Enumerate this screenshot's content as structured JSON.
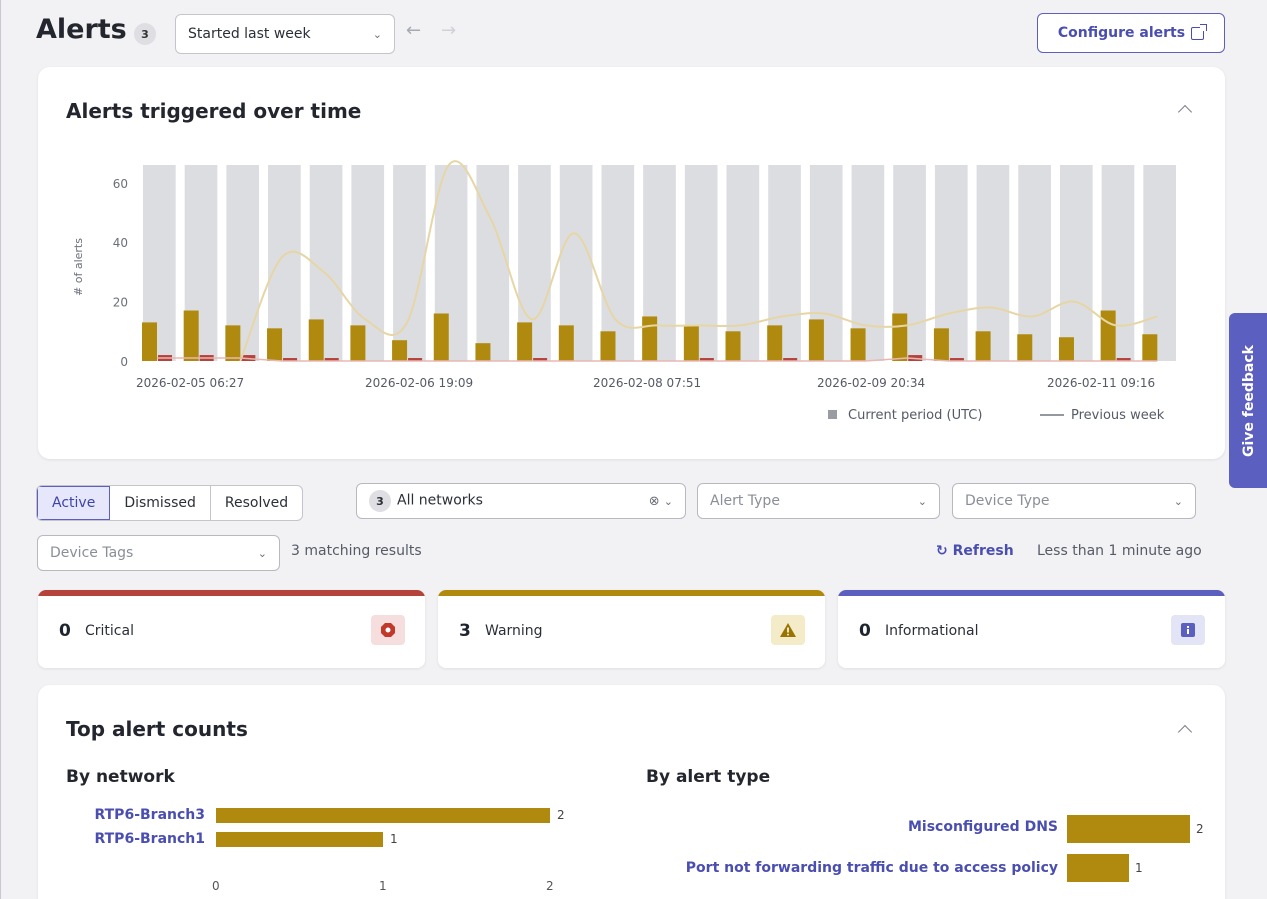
{
  "header": {
    "title": "Alerts",
    "count": "3",
    "period": "Started last week",
    "configure_label": "Configure alerts"
  },
  "chart_card": {
    "title": "Alerts triggered over time"
  },
  "chart_data": {
    "type": "bar",
    "ylabel": "# of alerts",
    "ylim": [
      0,
      66
    ],
    "yticks": [
      "0",
      "20",
      "40",
      "60"
    ],
    "xtick_labels": [
      "2026-02-05 06:27",
      "2026-02-06 19:09",
      "2026-02-08 07:51",
      "2026-02-09 20:34",
      "2026-02-11 09:16"
    ],
    "capacity": [
      66,
      66,
      66,
      66,
      66,
      66,
      66,
      66,
      66,
      66,
      66,
      66,
      66,
      66,
      66,
      66,
      66,
      66,
      66,
      66,
      66,
      66,
      66,
      66,
      66
    ],
    "series": [
      {
        "name": "Current period (UTC)",
        "type": "bar",
        "values": [
          13,
          17,
          12,
          11,
          14,
          12,
          7,
          16,
          6,
          13,
          12,
          10,
          15,
          12,
          10,
          12,
          14,
          11,
          16,
          11,
          10,
          9,
          8,
          17,
          9
        ]
      },
      {
        "name": "Previous week",
        "type": "line",
        "values": [
          null,
          null,
          0,
          35,
          30,
          14,
          13,
          66,
          48,
          14,
          43,
          14,
          12,
          12,
          12,
          15,
          16,
          12,
          12,
          16,
          18,
          15,
          20,
          12,
          15
        ]
      },
      {
        "name": "Critical",
        "type": "bar",
        "values": [
          2,
          2,
          2,
          1,
          1,
          0,
          1,
          0,
          0,
          1,
          0,
          0,
          0,
          1,
          0,
          1,
          0,
          0,
          2,
          1,
          0,
          0,
          0,
          1,
          0
        ]
      }
    ],
    "legend": [
      "Current period (UTC)",
      "Previous week"
    ],
    "legend_position": "bottom-right",
    "grid": false
  },
  "filters": {
    "tabs": [
      "Active",
      "Dismissed",
      "Resolved"
    ],
    "network_count": "3",
    "network_value": "All networks",
    "alert_type_placeholder": "Alert Type",
    "device_type_placeholder": "Device Type",
    "device_tags_placeholder": "Device Tags",
    "results": "3 matching results",
    "refresh_label": "Refresh",
    "updated": "Less than 1 minute ago"
  },
  "severity": [
    {
      "count": "0",
      "label": "Critical",
      "color": "#b3433b"
    },
    {
      "count": "3",
      "label": "Warning",
      "color": "#b08a0e"
    },
    {
      "count": "0",
      "label": "Informational",
      "color": "#5b5fbf"
    }
  ],
  "feedback_label": "Give feedback",
  "top_alerts": {
    "title": "Top alert counts",
    "by_network": {
      "title": "By network",
      "items": [
        {
          "label": "RTP6-Branch3",
          "value": 2
        },
        {
          "label": "RTP6-Branch1",
          "value": 1
        }
      ],
      "ticks": [
        "0",
        "1",
        "2"
      ]
    },
    "by_type": {
      "title": "By alert type",
      "items": [
        {
          "label": "Misconfigured DNS",
          "value": 2
        },
        {
          "label": "Port not forwarding traffic due to access policy",
          "value": 1
        }
      ]
    }
  }
}
